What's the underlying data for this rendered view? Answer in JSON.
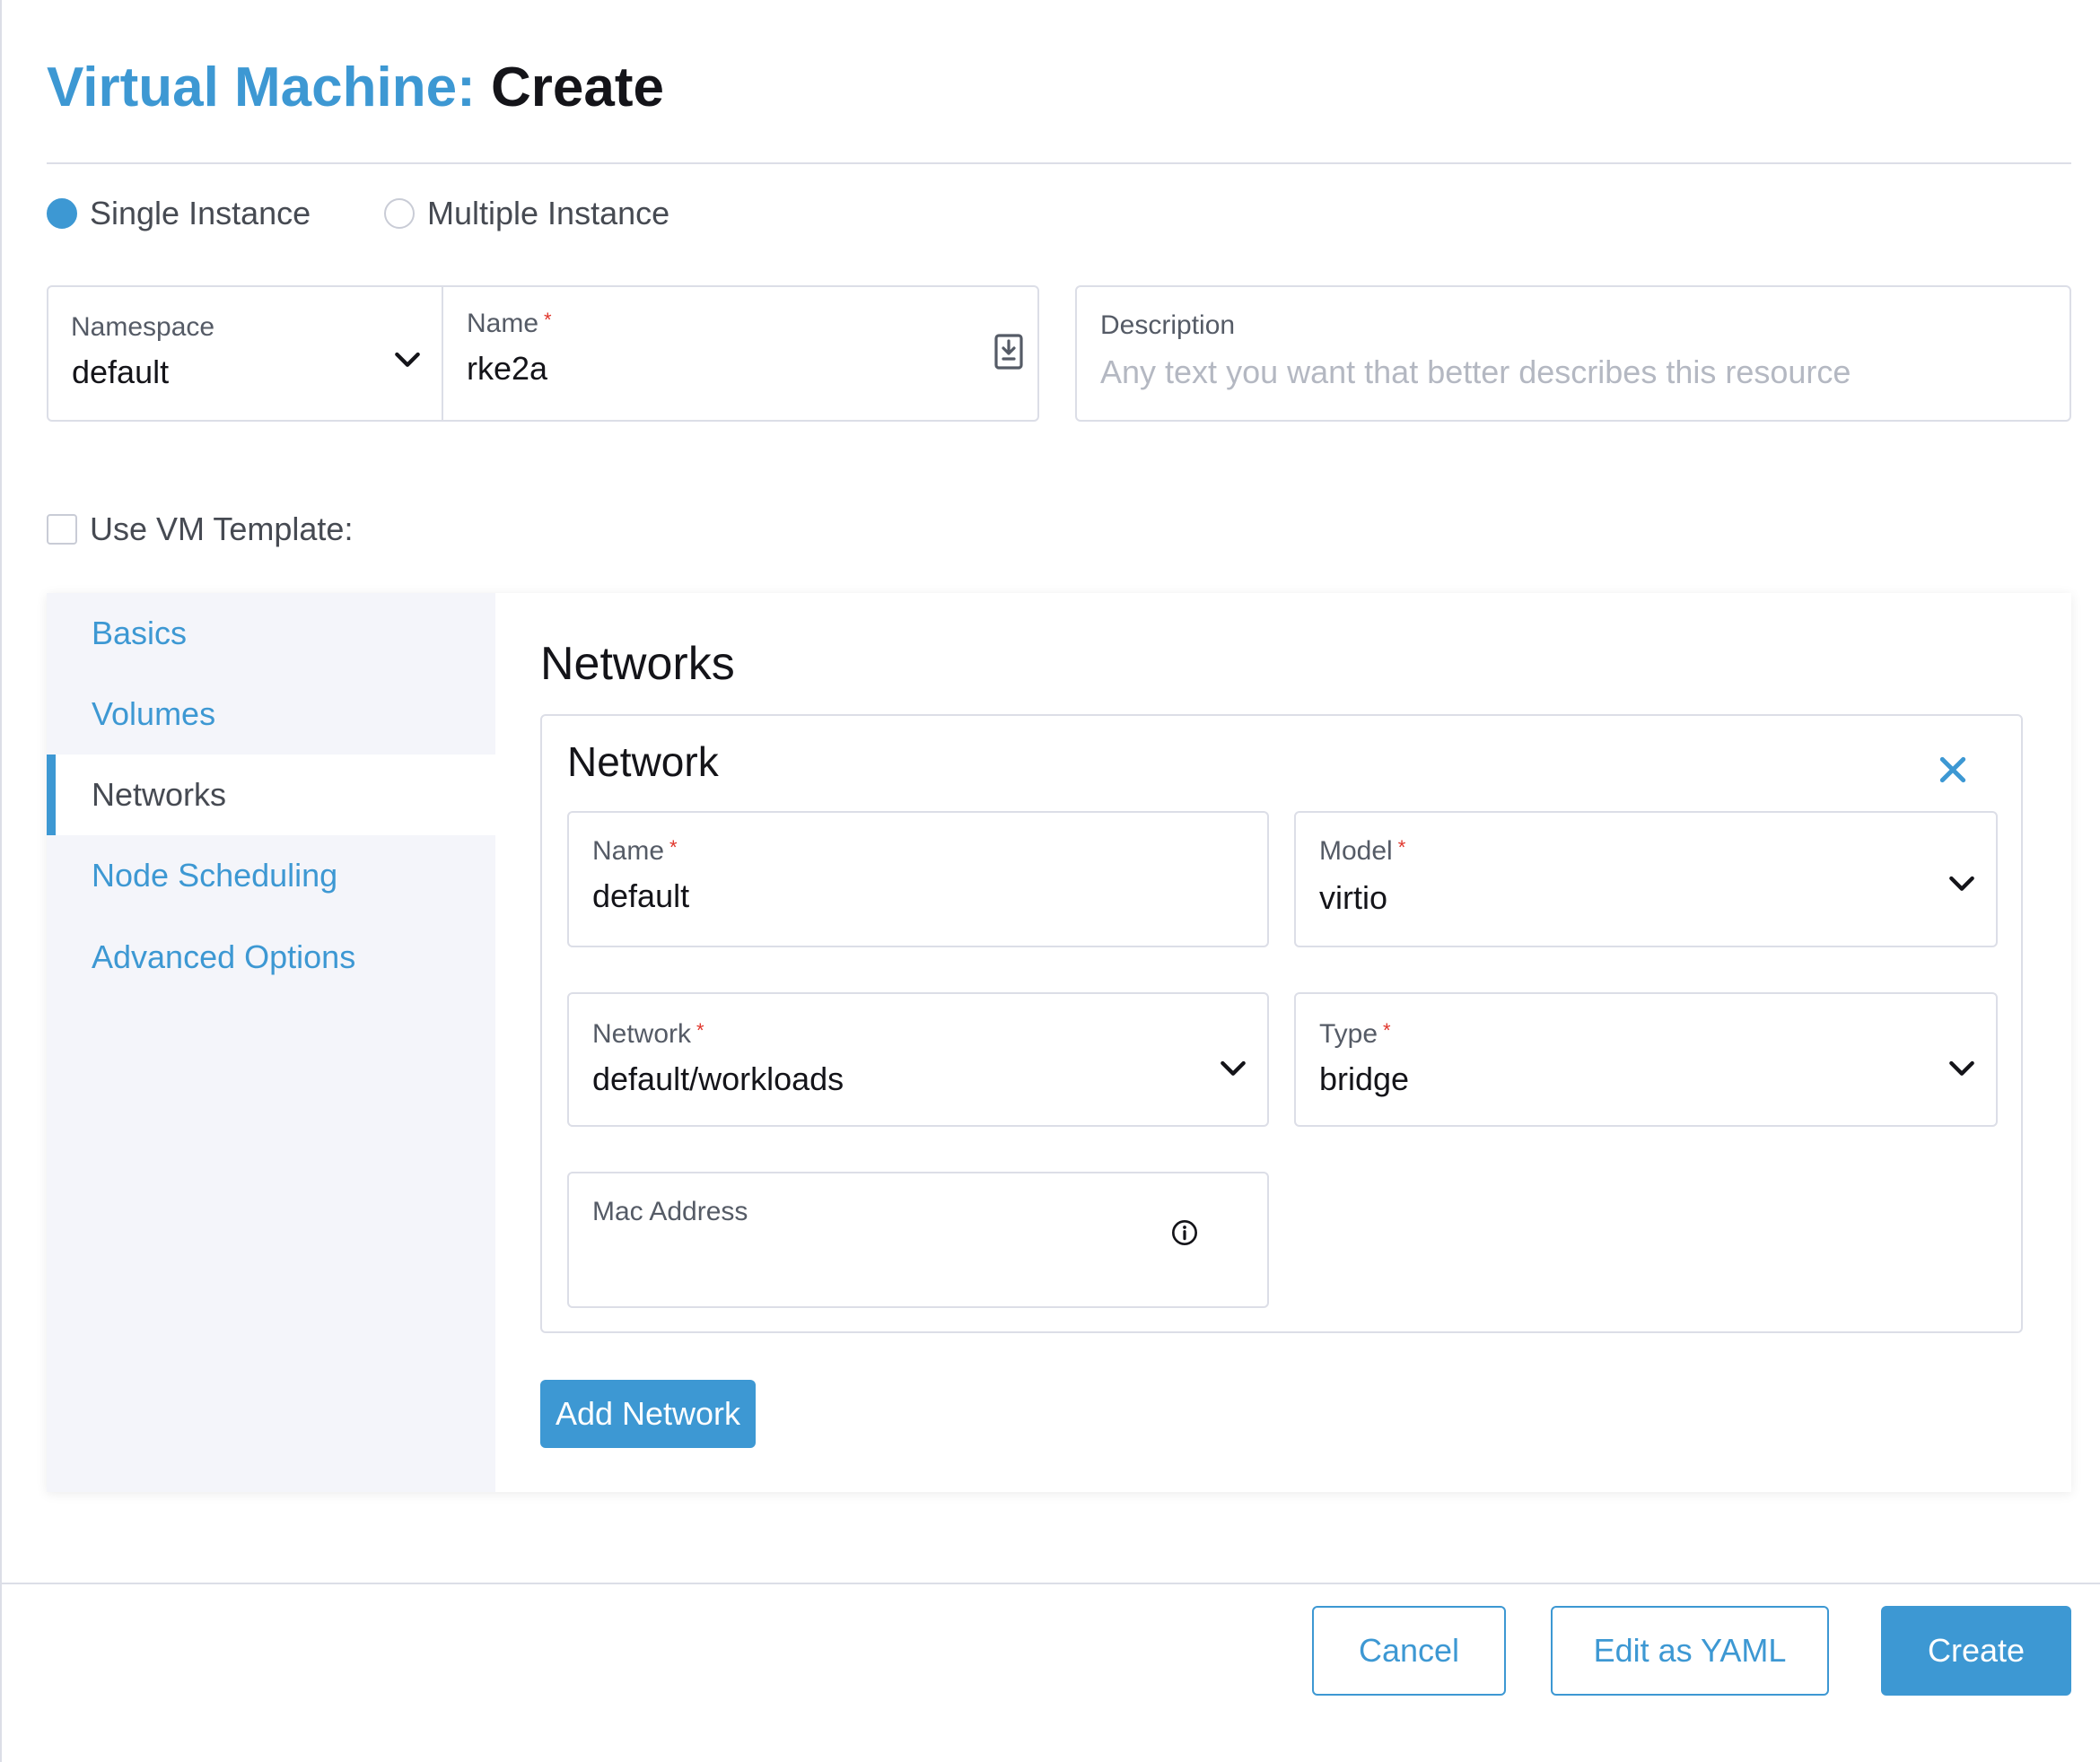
{
  "header": {
    "title_prefix": "Virtual Machine:",
    "title_action": "Create"
  },
  "instance_mode": {
    "options": [
      {
        "label": "Single Instance",
        "selected": true
      },
      {
        "label": "Multiple Instance",
        "selected": false
      }
    ]
  },
  "form": {
    "namespace": {
      "label": "Namespace",
      "value": "default"
    },
    "name": {
      "label": "Name",
      "required_mark": "*",
      "value": "rke2a"
    },
    "description": {
      "label": "Description",
      "placeholder": "Any text you want that better describes this resource"
    },
    "use_template": {
      "label": "Use VM Template:",
      "checked": false
    }
  },
  "sidebar": {
    "items": [
      {
        "label": "Basics"
      },
      {
        "label": "Volumes"
      },
      {
        "label": "Networks",
        "active": true
      },
      {
        "label": "Node Scheduling"
      },
      {
        "label": "Advanced Options"
      }
    ]
  },
  "networks": {
    "section_title": "Networks",
    "card_title": "Network",
    "fields": {
      "name": {
        "label": "Name",
        "value": "default"
      },
      "model": {
        "label": "Model",
        "value": "virtio"
      },
      "network": {
        "label": "Network",
        "value": "default/workloads"
      },
      "type": {
        "label": "Type",
        "value": "bridge"
      },
      "mac": {
        "label": "Mac Address",
        "value": ""
      }
    },
    "required_mark": "*",
    "add_button": "Add Network"
  },
  "footer": {
    "cancel": "Cancel",
    "edit_yaml": "Edit as YAML",
    "create": "Create"
  },
  "icons": {
    "dropdown": "chevron-down-icon",
    "remove": "close-icon",
    "info": "info-icon",
    "field_action": "clipboard-icon"
  },
  "colors": {
    "accent": "#3d98d3",
    "required": "#e0352b",
    "sidebar_bg": "#f4f5fa",
    "border": "#dcdee7"
  }
}
